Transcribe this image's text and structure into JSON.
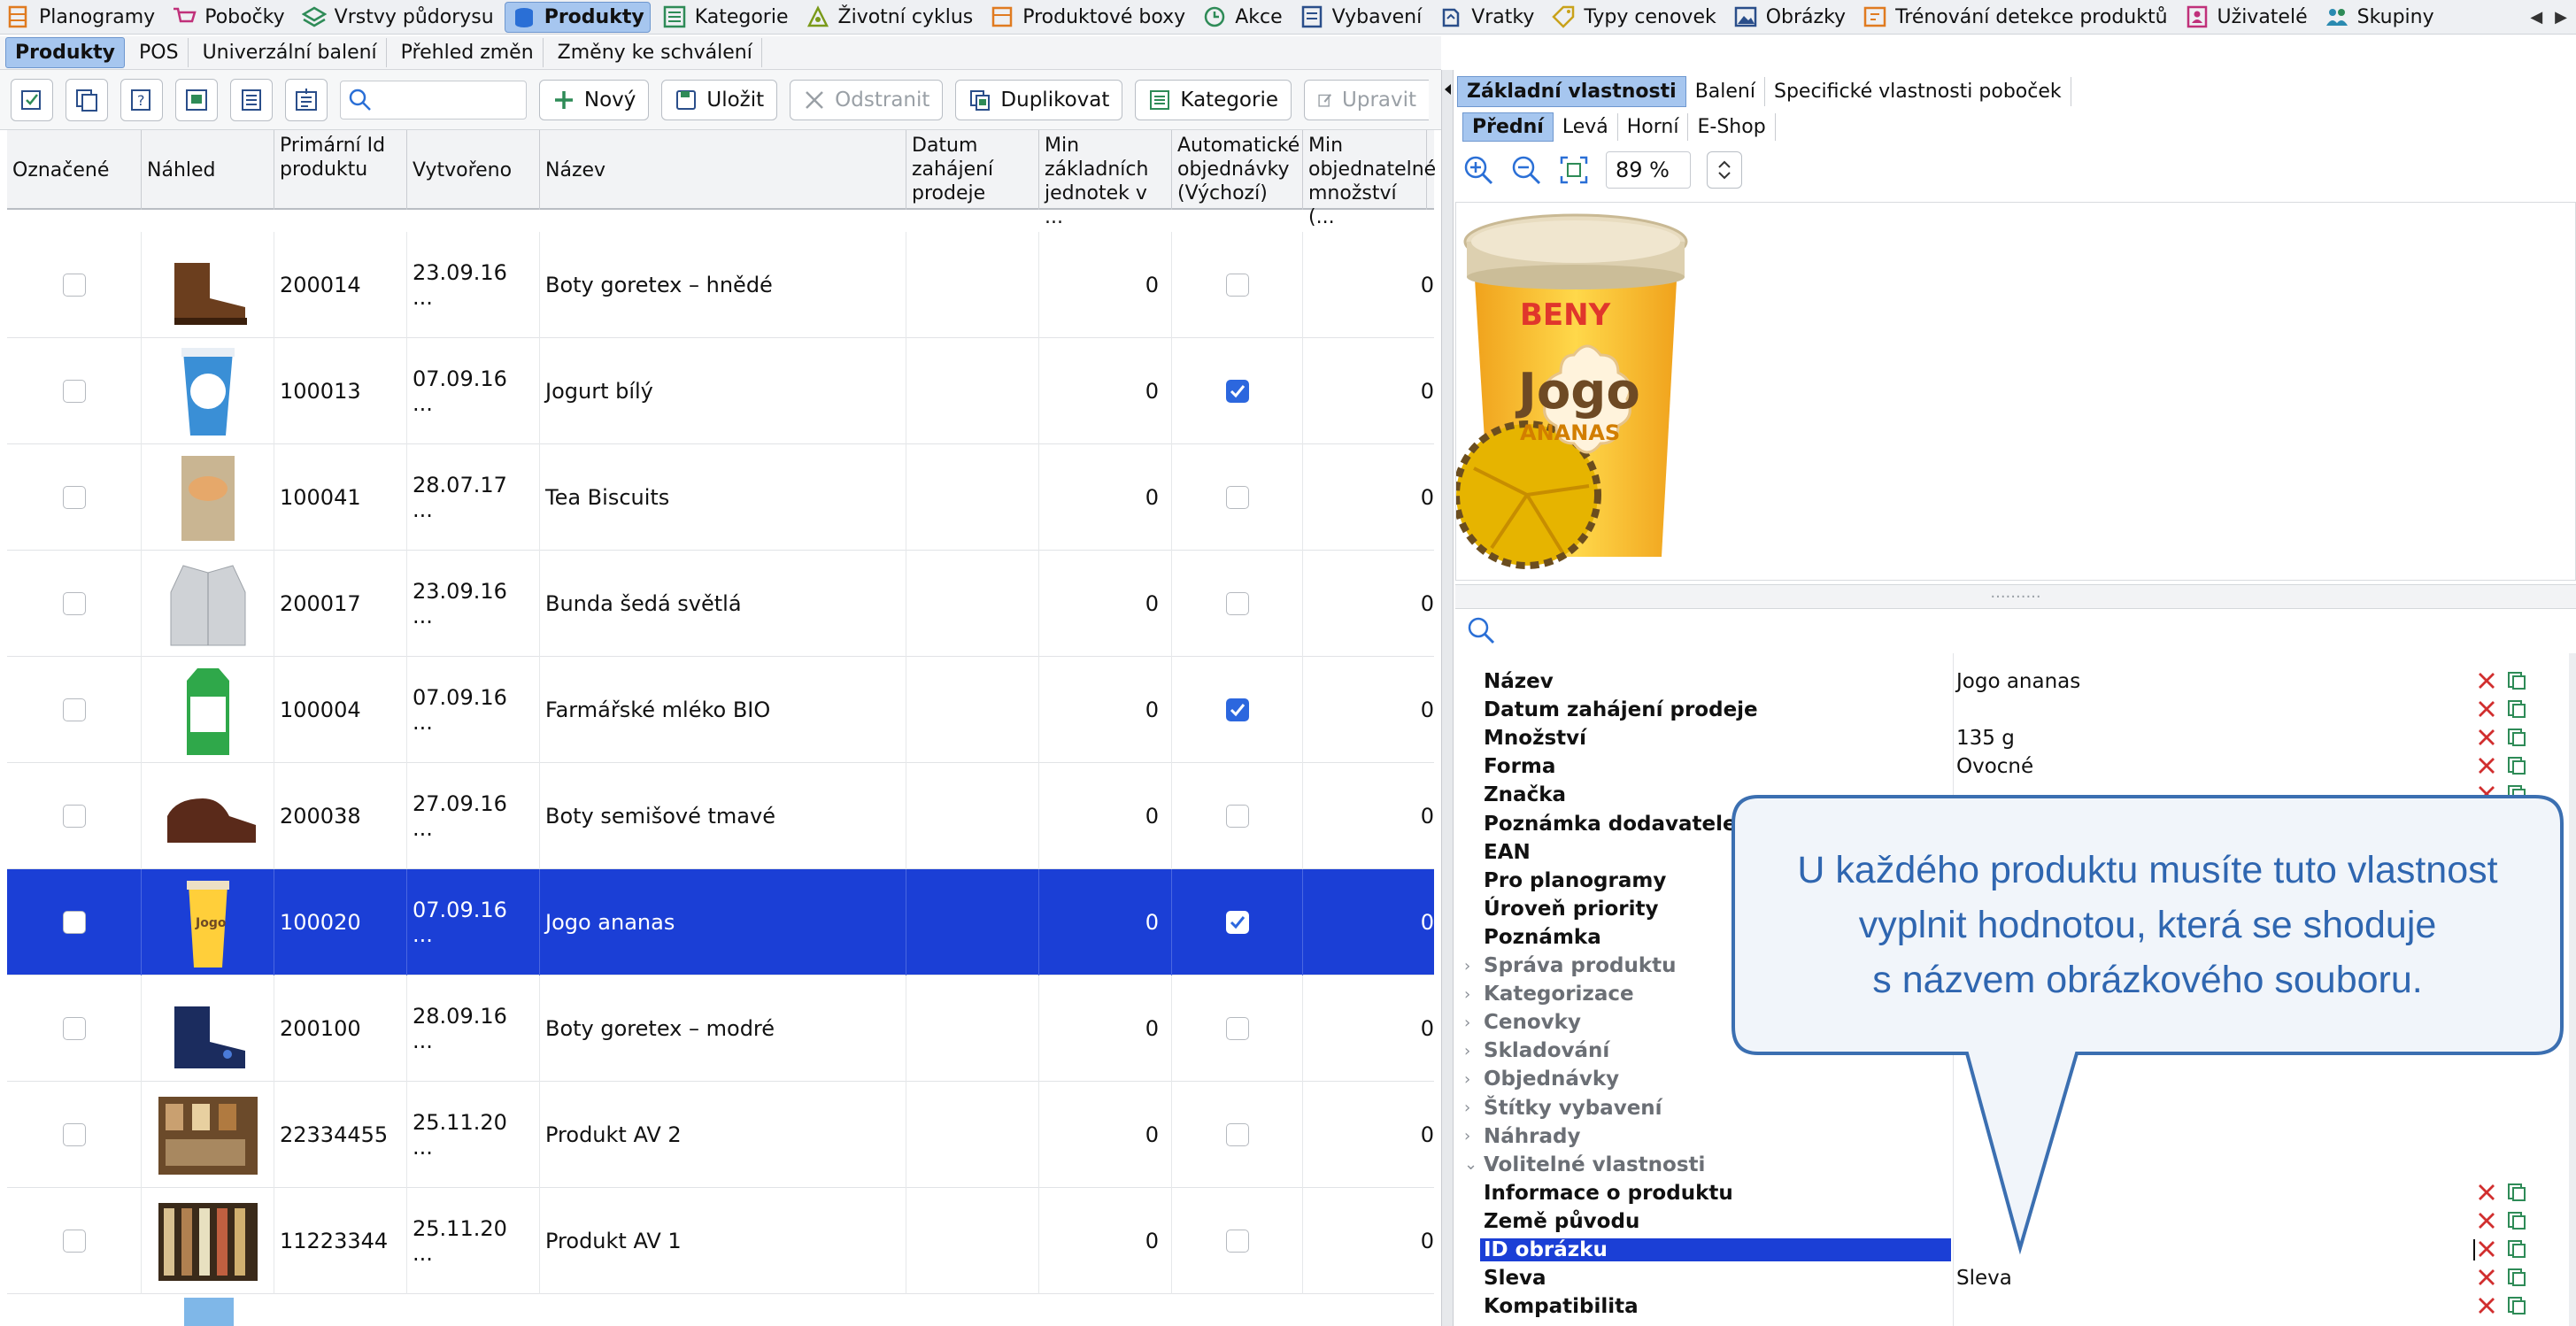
{
  "top_menu": [
    {
      "label": "Planogramy",
      "icon": "planogram-icon",
      "color": "#e07b20"
    },
    {
      "label": "Pobočky",
      "icon": "cart-icon",
      "color": "#c0307a"
    },
    {
      "label": "Vrstvy půdorysu",
      "icon": "layers-icon",
      "color": "#2e8b57"
    },
    {
      "label": "Produkty",
      "icon": "product-icon",
      "color": "#2a6fd6",
      "active": true
    },
    {
      "label": "Kategorie",
      "icon": "list-icon",
      "color": "#2e8b57"
    },
    {
      "label": "Životní cyklus",
      "icon": "lifecycle-icon",
      "color": "#7a9a1a"
    },
    {
      "label": "Produktové boxy",
      "icon": "box-icon",
      "color": "#e07b20"
    },
    {
      "label": "Akce",
      "icon": "clock-icon",
      "color": "#2e8b57"
    },
    {
      "label": "Vybavení",
      "icon": "equipment-icon",
      "color": "#2a4e8a"
    },
    {
      "label": "Vratky",
      "icon": "return-icon",
      "color": "#2a4e8a"
    },
    {
      "label": "Typy cenovek",
      "icon": "price-tag-icon",
      "color": "#c9a21a"
    },
    {
      "label": "Obrázky",
      "icon": "image-icon",
      "color": "#2a4e8a"
    },
    {
      "label": "Trénování detekce produktů",
      "icon": "training-icon",
      "color": "#e07b20"
    },
    {
      "label": "Uživatelé",
      "icon": "user-icon",
      "color": "#c0307a"
    },
    {
      "label": "Skupiny",
      "icon": "group-icon",
      "color": "#2a8ab0"
    }
  ],
  "left_tabs": [
    {
      "label": "Produkty",
      "active": true
    },
    {
      "label": "POS"
    },
    {
      "label": "Univerzální balení"
    },
    {
      "label": "Přehled změn"
    },
    {
      "label": "Změny ke schválení"
    }
  ],
  "toolbar": {
    "search_placeholder": "",
    "new_label": "Nový",
    "save_label": "Uložit",
    "delete_label": "Odstranit",
    "duplicate_label": "Duplikovat",
    "category_label": "Kategorie",
    "edit_label": "Upravit"
  },
  "table": {
    "columns": [
      "Označené",
      "Náhled",
      "Primární Id produktu",
      "Vytvořeno",
      "Název",
      "Datum zahájení prodeje",
      "Min základních jednotek v ...",
      "Automatické objednávky (Výchozí)",
      "Min objednatelné množství (..."
    ],
    "rows": [
      {
        "id": "200014",
        "created": "23.09.16 ...",
        "name": "Boty goretex – hnědé",
        "start": "",
        "min_units": "0",
        "auto": false,
        "min_order": "0",
        "thumb": "boot-brown"
      },
      {
        "id": "100013",
        "created": "07.09.16 ...",
        "name": "Jogurt bílý",
        "start": "",
        "min_units": "0",
        "auto": true,
        "min_order": "0",
        "thumb": "yogurt"
      },
      {
        "id": "100041",
        "created": "28.07.17 ...",
        "name": "Tea Biscuits",
        "start": "",
        "min_units": "0",
        "auto": false,
        "min_order": "0",
        "thumb": "biscuits"
      },
      {
        "id": "200017",
        "created": "23.09.16 ...",
        "name": "Bunda šedá světlá",
        "start": "",
        "min_units": "0",
        "auto": false,
        "min_order": "0",
        "thumb": "jacket"
      },
      {
        "id": "100004",
        "created": "07.09.16 ...",
        "name": "Farmářské mléko BIO",
        "start": "",
        "min_units": "0",
        "auto": true,
        "min_order": "0",
        "thumb": "milk"
      },
      {
        "id": "200038",
        "created": "27.09.16 ...",
        "name": "Boty semišové tmavé",
        "start": "",
        "min_units": "0",
        "auto": false,
        "min_order": "0",
        "thumb": "shoe-dark"
      },
      {
        "id": "100020",
        "created": "07.09.16 ...",
        "name": "Jogo ananas",
        "start": "",
        "min_units": "0",
        "auto": true,
        "min_order": "0",
        "thumb": "jogo",
        "selected": true
      },
      {
        "id": "200100",
        "created": "28.09.16 ...",
        "name": "Boty goretex – modré",
        "start": "",
        "min_units": "0",
        "auto": false,
        "min_order": "0",
        "thumb": "boot-blue"
      },
      {
        "id": "22334455",
        "created": "25.11.20 ...",
        "name": "Produkt AV 2",
        "start": "",
        "min_units": "0",
        "auto": false,
        "min_order": "0",
        "thumb": "shelf"
      },
      {
        "id": "11223344",
        "created": "25.11.20 ...",
        "name": "Produkt AV 1",
        "start": "",
        "min_units": "0",
        "auto": false,
        "min_order": "0",
        "thumb": "shelf2"
      }
    ]
  },
  "right_tabs": [
    {
      "label": "Základní vlastnosti",
      "active": true
    },
    {
      "label": "Balení"
    },
    {
      "label": "Specifické vlastnosti poboček"
    }
  ],
  "view_tabs": [
    {
      "label": "Přední",
      "active": true
    },
    {
      "label": "Levá"
    },
    {
      "label": "Horní"
    },
    {
      "label": "E-Shop"
    }
  ],
  "zoom": {
    "value": "89 %"
  },
  "preview": {
    "brand": "BENY",
    "product": "Jogo",
    "flavor": "ANANAS"
  },
  "property_search_placeholder": "",
  "properties": [
    {
      "key": "Název",
      "value": "Jogo ananas",
      "type": "field"
    },
    {
      "key": "Datum zahájení prodeje",
      "value": "",
      "type": "field"
    },
    {
      "key": "Množství",
      "value": "135 g",
      "type": "field"
    },
    {
      "key": "Forma",
      "value": "Ovocné",
      "type": "field"
    },
    {
      "key": "Značka",
      "value": "",
      "type": "field"
    },
    {
      "key": "Poznámka dodavatele",
      "value": "",
      "type": "field"
    },
    {
      "key": "EAN",
      "value": "",
      "type": "field"
    },
    {
      "key": "Pro planogramy",
      "value": "",
      "type": "field"
    },
    {
      "key": "Úroveň priority",
      "value": "",
      "type": "field"
    },
    {
      "key": "Poznámka",
      "value": "",
      "type": "field"
    },
    {
      "key": "Správa produktu",
      "value": "",
      "type": "group"
    },
    {
      "key": "Kategorizace",
      "value": "",
      "type": "group"
    },
    {
      "key": "Cenovky",
      "value": "",
      "type": "group"
    },
    {
      "key": "Skladování",
      "value": "",
      "type": "group"
    },
    {
      "key": "Objednávky",
      "value": "",
      "type": "group"
    },
    {
      "key": "Štítky vybavení",
      "value": "",
      "type": "group"
    },
    {
      "key": "Náhrady",
      "value": "",
      "type": "group"
    },
    {
      "key": "Volitelné vlastnosti",
      "value": "",
      "type": "group-open"
    },
    {
      "key": "Informace o produktu",
      "value": "",
      "type": "field"
    },
    {
      "key": "Země původu",
      "value": "",
      "type": "field"
    },
    {
      "key": "ID obrázku",
      "value": "",
      "type": "field",
      "highlight": true
    },
    {
      "key": "Sleva",
      "value": "Sleva",
      "type": "field"
    },
    {
      "key": "Kompatibilita",
      "value": "",
      "type": "field"
    }
  ],
  "callout": {
    "line1": "U každého produktu musíte tuto vlastnost",
    "line2": "vyplnit hodnotou, která se shoduje",
    "line3": "s názvem obrázkového souboru."
  },
  "colors": {
    "accent": "#a6c6ef",
    "selection": "#1b3fd6",
    "callout_border": "#3b6fb1",
    "callout_text": "#2f66b0",
    "callout_fill": "#f1f5fa"
  }
}
